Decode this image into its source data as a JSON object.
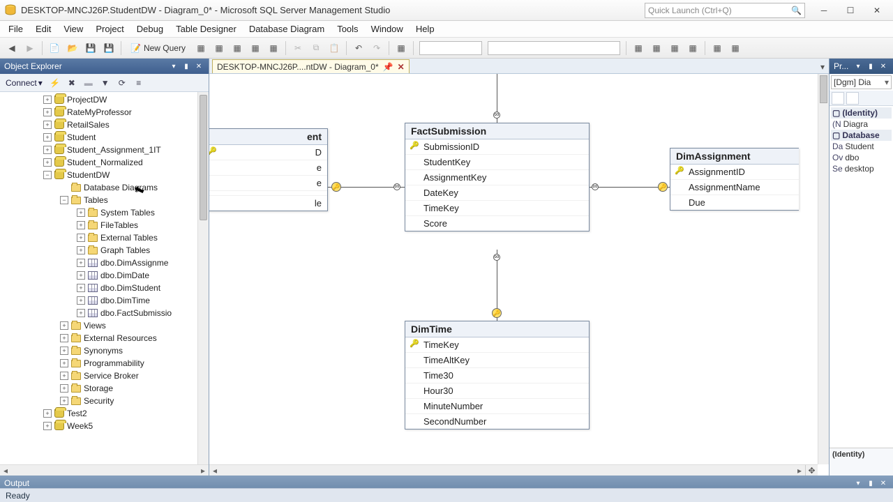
{
  "window": {
    "title": "DESKTOP-MNCJ26P.StudentDW - Diagram_0* - Microsoft SQL Server Management Studio",
    "quicklaunch_placeholder": "Quick Launch (Ctrl+Q)"
  },
  "menu": {
    "file": "File",
    "edit": "Edit",
    "view": "View",
    "project": "Project",
    "debug": "Debug",
    "table_designer": "Table Designer",
    "database_diagram": "Database Diagram",
    "tools": "Tools",
    "window": "Window",
    "help": "Help"
  },
  "toolbar": {
    "new_query": "New Query"
  },
  "object_explorer": {
    "title": "Object Explorer",
    "connect": "Connect",
    "nodes": {
      "projectdw": "ProjectDW",
      "ratemyprof": "RateMyProfessor",
      "retailsales": "RetailSales",
      "student": "Student",
      "student_assign": "Student_Assignment_1IT",
      "student_norm": "Student_Normalized",
      "studentdw": "StudentDW",
      "db_diagrams": "Database Diagrams",
      "tables": "Tables",
      "sys_tables": "System Tables",
      "filetables": "FileTables",
      "ext_tables": "External Tables",
      "graph_tables": "Graph Tables",
      "dbo_dimassign": "dbo.DimAssignme",
      "dbo_dimdate": "dbo.DimDate",
      "dbo_dimstudent": "dbo.DimStudent",
      "dbo_dimtime": "dbo.DimTime",
      "dbo_factsub": "dbo.FactSubmissio",
      "views": "Views",
      "ext_res": "External Resources",
      "synonyms": "Synonyms",
      "programmability": "Programmability",
      "service_broker": "Service Broker",
      "storage": "Storage",
      "security": "Security",
      "test2": "Test2",
      "week5": "Week5"
    }
  },
  "tabs": {
    "diagram": "DESKTOP-MNCJ26P....ntDW - Diagram_0*"
  },
  "diagram": {
    "dimstudent": {
      "title": "ent",
      "cols": [
        "D",
        "e",
        "e",
        "le"
      ]
    },
    "factsubmission": {
      "title": "FactSubmission",
      "cols": [
        "SubmissionID",
        "StudentKey",
        "AssignmentKey",
        "DateKey",
        "TimeKey",
        "Score"
      ]
    },
    "dimassignment": {
      "title": "DimAssignment",
      "cols": [
        "AssignmentID",
        "AssignmentName",
        "Due"
      ]
    },
    "dimtime": {
      "title": "DimTime",
      "cols": [
        "TimeKey",
        "TimeAltKey",
        "Time30",
        "Hour30",
        "MinuteNumber",
        "SecondNumber"
      ]
    }
  },
  "properties": {
    "title": "Pr...",
    "combo": "[Dgm] Dia",
    "identity_hdr": "(Identity)",
    "name_k": "(N",
    "name_v": "Diagra",
    "db_hdr": "Database",
    "da_k": "Da",
    "da_v": "Student",
    "ov_k": "Ov",
    "ov_v": "dbo",
    "se_k": "Se",
    "se_v": "desktop",
    "footer": "(Identity)"
  },
  "output": {
    "title": "Output"
  },
  "status": {
    "text": "Ready"
  }
}
